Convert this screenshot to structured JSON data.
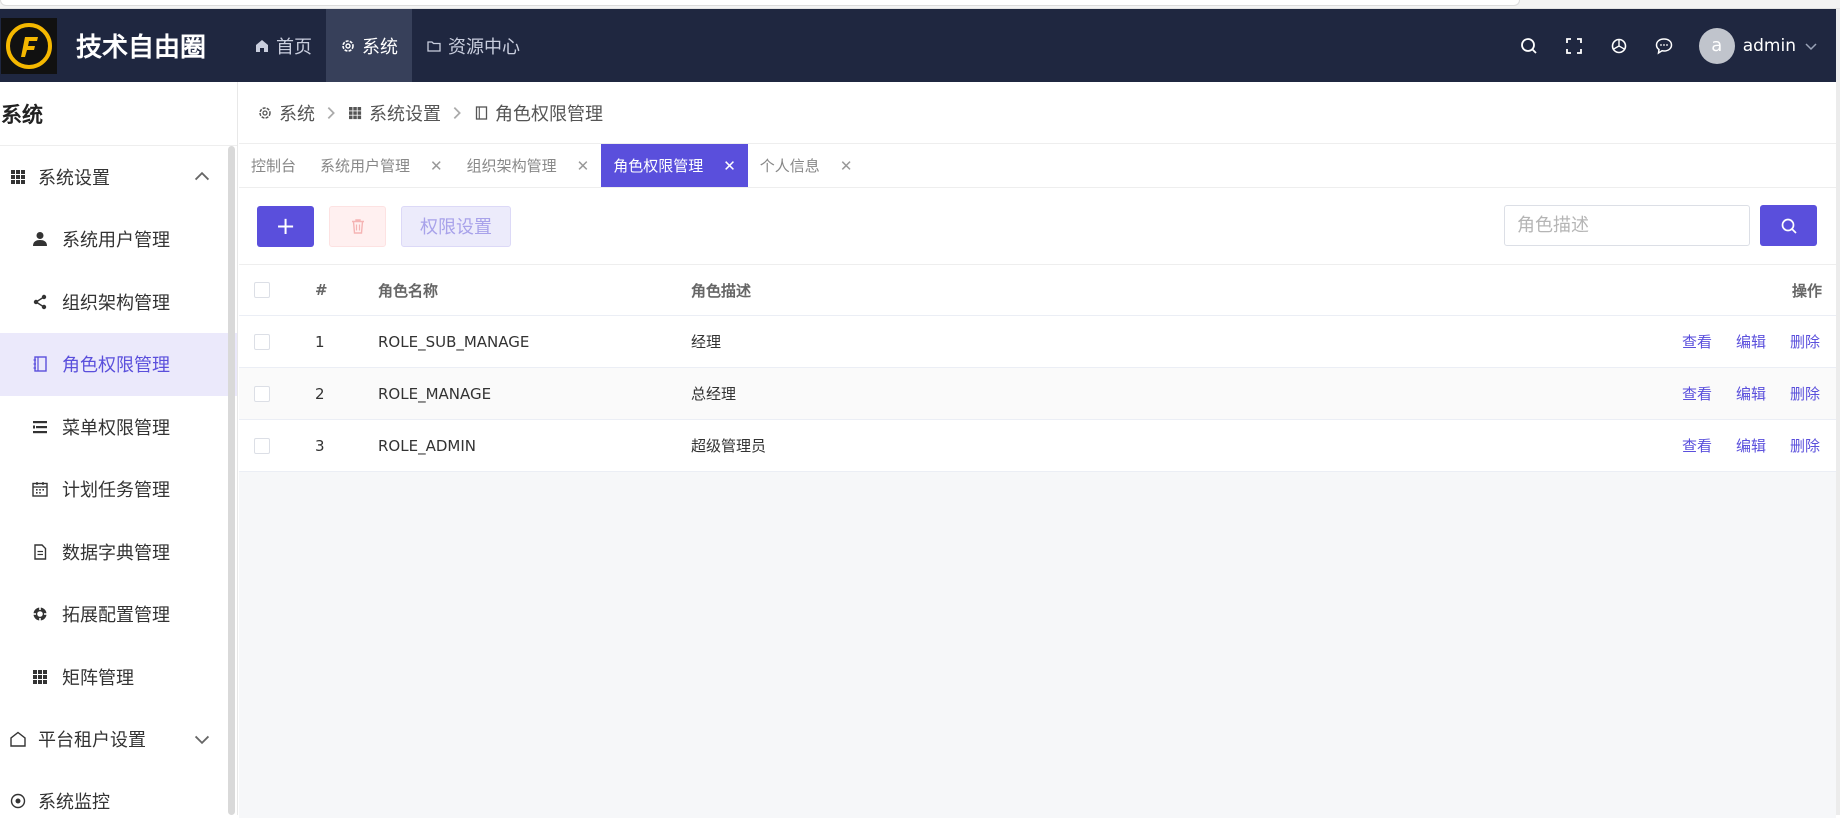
{
  "app": {
    "brand": "技术自由圈",
    "logo_icon": "flame-f-logo"
  },
  "topnav": {
    "items": [
      {
        "label": "首页",
        "icon": "home-icon"
      },
      {
        "label": "系统",
        "icon": "gear-icon"
      },
      {
        "label": "资源中心",
        "icon": "folder-icon"
      }
    ],
    "user": {
      "avatar_letter": "a",
      "name": "admin"
    }
  },
  "sidebar": {
    "title": "系统",
    "groups": [
      {
        "label": "系统设置",
        "icon": "grid-icon",
        "expanded": true
      },
      {
        "label": "平台租户设置",
        "icon": "home-outline-icon",
        "expanded": false
      },
      {
        "label": "系统监控",
        "icon": "monitor-icon"
      }
    ],
    "items": [
      {
        "label": "系统用户管理",
        "icon": "user-icon"
      },
      {
        "label": "组织架构管理",
        "icon": "share-icon"
      },
      {
        "label": "角色权限管理",
        "icon": "notebook-icon",
        "active": true
      },
      {
        "label": "菜单权限管理",
        "icon": "list-icon"
      },
      {
        "label": "计划任务管理",
        "icon": "calendar-icon"
      },
      {
        "label": "数据字典管理",
        "icon": "document-icon"
      },
      {
        "label": "拓展配置管理",
        "icon": "lifebuoy-icon"
      },
      {
        "label": "矩阵管理",
        "icon": "grid-icon"
      }
    ]
  },
  "breadcrumb": {
    "items": [
      "系统",
      "系统设置",
      "角色权限管理"
    ]
  },
  "tabs": [
    {
      "label": "控制台",
      "closable": false
    },
    {
      "label": "系统用户管理",
      "closable": true
    },
    {
      "label": "组织架构管理",
      "closable": true
    },
    {
      "label": "角色权限管理",
      "closable": true,
      "active": true
    },
    {
      "label": "个人信息",
      "closable": true
    }
  ],
  "toolbar": {
    "add_label": "+",
    "perm_label": "权限设置",
    "search_placeholder": "角色描述"
  },
  "table": {
    "columns": [
      "#",
      "角色名称",
      "角色描述",
      "操作"
    ],
    "rows": [
      {
        "index": "1",
        "name": "ROLE_SUB_MANAGE",
        "desc": "经理"
      },
      {
        "index": "2",
        "name": "ROLE_MANAGE",
        "desc": "总经理"
      },
      {
        "index": "3",
        "name": "ROLE_ADMIN",
        "desc": "超级管理员"
      }
    ],
    "actions": [
      "查看",
      "编辑",
      "删除"
    ]
  },
  "colors": {
    "topbar": "#1f2740",
    "accent": "#5a4fdc",
    "logo_yellow": "#f5b800"
  }
}
